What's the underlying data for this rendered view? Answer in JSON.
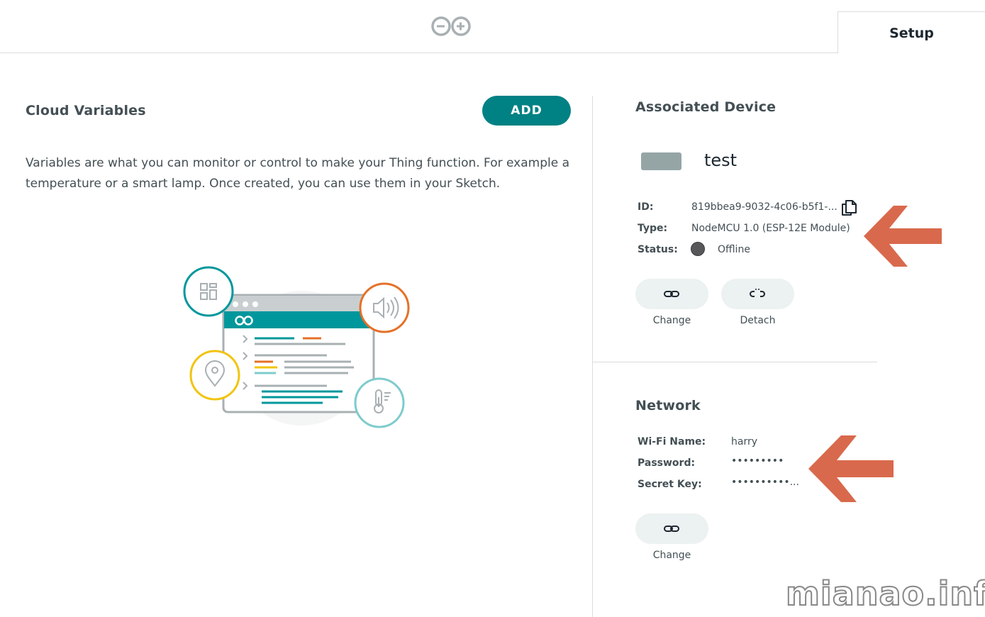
{
  "header": {
    "logo_icon": "arduino-infinity-logo-icon",
    "tab_label": "Setup"
  },
  "cloud_variables": {
    "title": "Cloud Variables",
    "add_label": "ADD",
    "description": "Variables are what you can monitor or control to make your Thing function. For example a temperature or a smart lamp. Once created, you can use them in your Sketch."
  },
  "device": {
    "title": "Associated Device",
    "name": "test",
    "id_label": "ID:",
    "id_value": "819bbea9-9032-4c06-b5f1-...",
    "type_label": "Type:",
    "type_value": "NodeMCU 1.0 (ESP-12E Module)",
    "status_label": "Status:",
    "status_value": "Offline",
    "change_label": "Change",
    "detach_label": "Detach"
  },
  "network": {
    "title": "Network",
    "wifi_label": "Wi-Fi Name:",
    "wifi_value": "harry",
    "password_label": "Password:",
    "password_value": "•••••••••",
    "secret_label": "Secret Key:",
    "secret_value": "••••••••••...",
    "change_label": "Change"
  },
  "watermark": "mianao.info",
  "colors": {
    "accent": "#008184",
    "arrow": "#d9694c",
    "status_offline": "#58585a"
  }
}
